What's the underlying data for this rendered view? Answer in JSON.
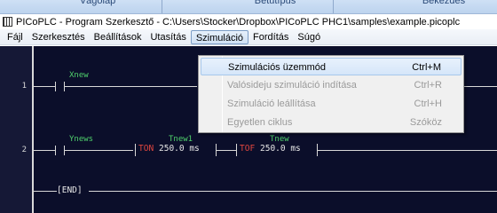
{
  "background_tabs": [
    "Vágólap",
    "Betűtípus",
    "Bekezdés"
  ],
  "window": {
    "title": "PICoPLC - Program Szerkesztő - C:\\Users\\Stocker\\Dropbox\\PICoPLC PHC1\\samples\\example.picoplc"
  },
  "menubar": {
    "items": [
      "Fájl",
      "Szerkesztés",
      "Beállítások",
      "Utasítás",
      "Szimuláció",
      "Fordítás",
      "Súgó"
    ],
    "active": "Szimuláció"
  },
  "dropdown": {
    "items": [
      {
        "label": "Szimulációs üzemmód",
        "shortcut": "Ctrl+M",
        "enabled": true,
        "highlighted": true
      },
      {
        "label": "Valósideju szimuláció indítása",
        "shortcut": "Ctrl+R",
        "enabled": false
      },
      {
        "label": "Szimuláció leállítása",
        "shortcut": "Ctrl+H",
        "enabled": false
      },
      {
        "label": "Egyetlen ciklus",
        "shortcut": "Szóköz",
        "enabled": false
      }
    ]
  },
  "ladder": {
    "rungs": [
      {
        "number": "1",
        "contact": "Xnew"
      },
      {
        "number": "2",
        "contact": "Ynews",
        "timer1": {
          "name": "Tnew1",
          "type": "TON",
          "value": "250.0 ms"
        },
        "timer2": {
          "name": "Tnew",
          "type": "TOF",
          "value": "250.0 ms"
        }
      }
    ],
    "end_label": "[END]"
  },
  "colors": {
    "editor_bg": "#0b0e2a",
    "contact_label": "#4fd06c",
    "timer_type": "#e0463f",
    "wire": "#d8d8d8"
  }
}
